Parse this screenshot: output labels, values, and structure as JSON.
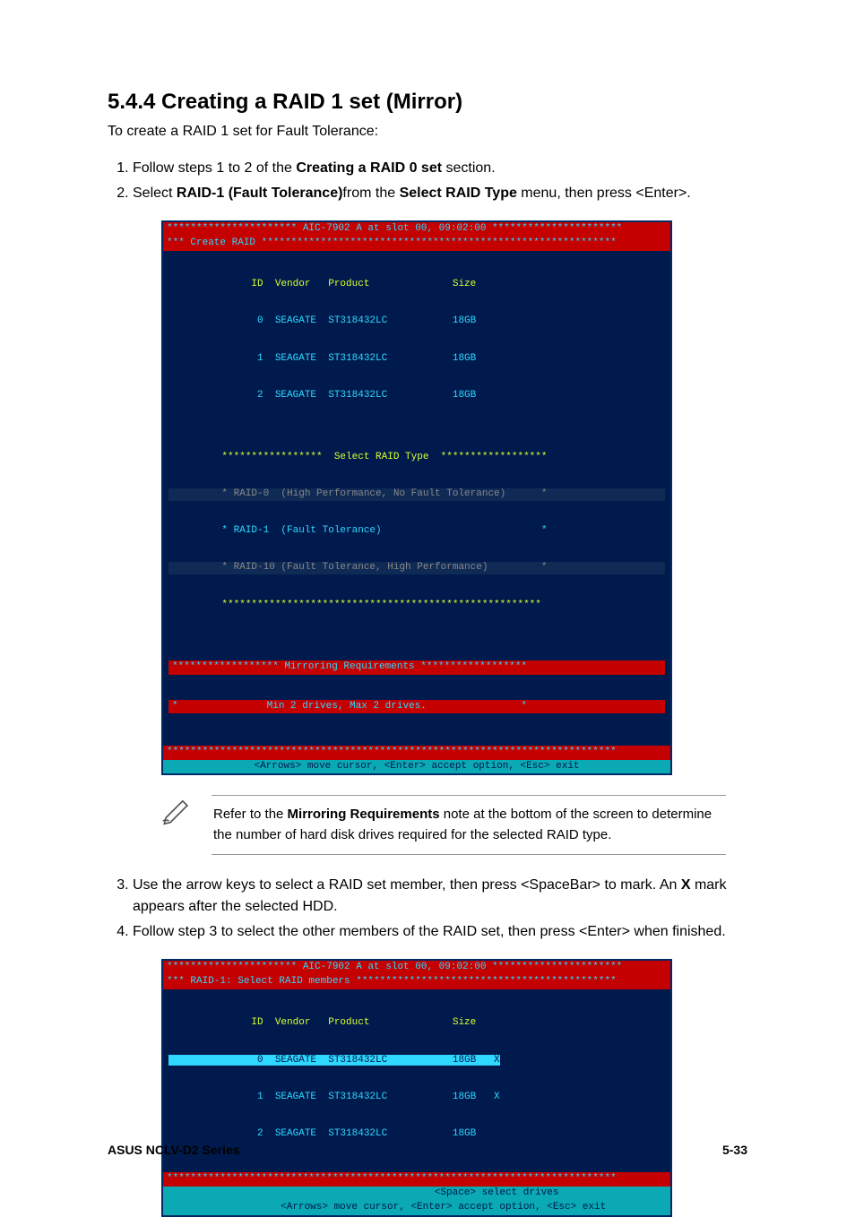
{
  "heading": "5.4.4   Creating a RAID 1 set (Mirror)",
  "intro": "To create a RAID 1 set for Fault Tolerance:",
  "steps12": {
    "s1a": "Follow steps 1 to 2 of the ",
    "s1b": "Creating a RAID 0 set",
    "s1c": " section.",
    "s2a": "Select ",
    "s2b": "RAID-1 (Fault Tolerance)",
    "s2c": "from the ",
    "s2d": "Select RAID Type",
    "s2e": " menu, then press <Enter>."
  },
  "shot1": {
    "top": "********************** AIC-7902 A at slot 00, 09:02:00 **********************",
    "title": "*** Create RAID ************************************************************",
    "cols": "              ID  Vendor   Product              Size",
    "row0": "               0  SEAGATE  ST318432LC           18GB",
    "row1": "               1  SEAGATE  ST318432LC           18GB",
    "row2": "               2  SEAGATE  ST318432LC           18GB",
    "selhead": "         *****************  Select RAID Type  ******************",
    "sel0": "         * RAID-0  (High Performance, No Fault Tolerance)      *",
    "sel1": "         * RAID-1  (Fault Tolerance)                           *",
    "sel2": "         * RAID-10 (Fault Tolerance, High Performance)         *",
    "selend": "         ******************************************************",
    "mirrorHead": "****************** Mirroring Requirements ******************",
    "mirrorBody": "*               Min 2 drives, Max 2 drives.                *",
    "foot": "<Arrows> move cursor, <Enter> accept option, <Esc> exit"
  },
  "note": {
    "a": "Refer to the ",
    "b": "Mirroring Requirements",
    "c": " note at the bottom of the screen to determine the number of hard disk drives required for the selected RAID type."
  },
  "steps34": {
    "s3a": "Use the arrow keys to select a RAID set member, then press <SpaceBar> to mark. An ",
    "s3b": "X",
    "s3c": " mark appears after the selected HDD.",
    "s4": "Follow step 3 to select the other members of the RAID set, then press <Enter> when finished."
  },
  "shot2": {
    "top": "********************** AIC-7902 A at slot 00, 09:02:00 **********************",
    "title": "*** RAID-1: Select RAID members ********************************************",
    "cols": "              ID  Vendor   Product              Size",
    "row0": "               0  SEAGATE  ST318432LC           18GB   X",
    "row1": "               1  SEAGATE  ST318432LC           18GB   X",
    "row2": "               2  SEAGATE  ST318432LC           18GB",
    "foot1": "                           <Space> select drives",
    "foot2": "         <Arrows> move cursor, <Enter> accept option, <Esc> exit"
  },
  "footer": {
    "left": "ASUS NCLV-D2 Series",
    "right": "5-33"
  }
}
